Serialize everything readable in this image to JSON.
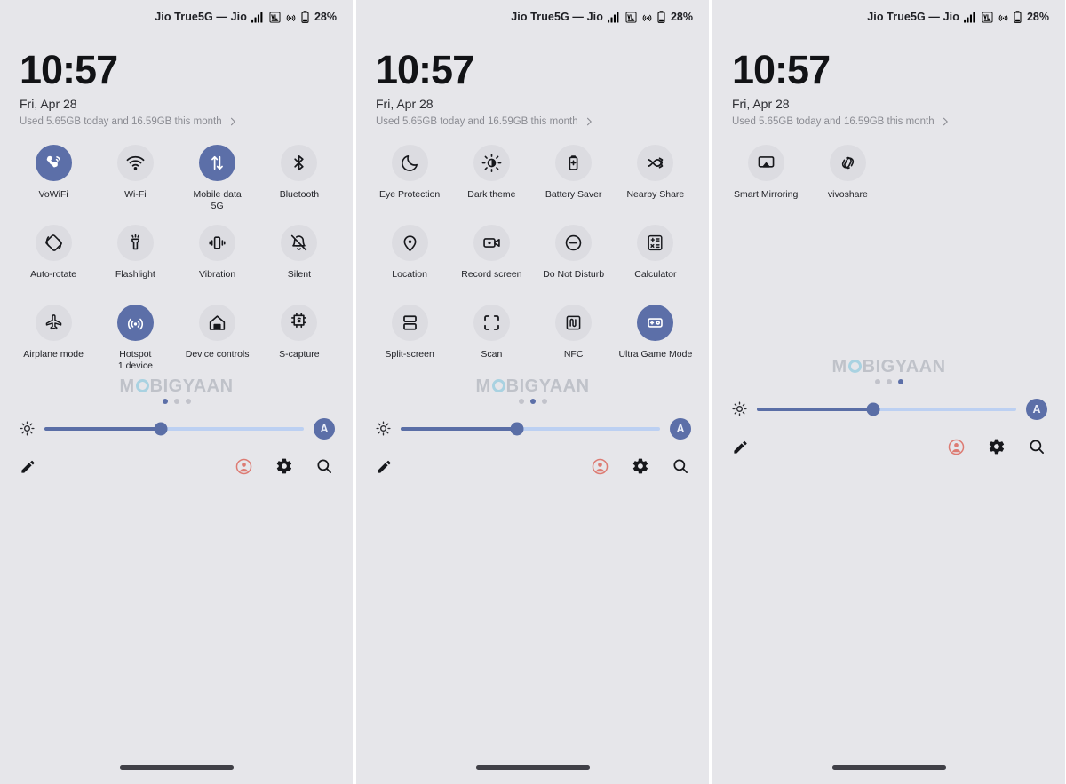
{
  "statusbar": {
    "carrier": "Jio True5G — Jio",
    "icons": [
      "signal-bars-icon",
      "volte-icon",
      "hotspot-icon",
      "battery-icon"
    ],
    "battery_percent": "28%"
  },
  "header": {
    "clock": "10:57",
    "date": "Fri, Apr 28",
    "data_usage": "Used 5.65GB today and 16.59GB this month",
    "chevron": "chevron-right-icon"
  },
  "brightness": {
    "sun_icon": "brightness-icon",
    "value_percent": 45,
    "auto_label": "A"
  },
  "bottom_actions": [
    {
      "name": "edit-tiles-button",
      "icon": "pencil-icon",
      "color": "#17181c"
    },
    {
      "name": "user-profile-button",
      "icon": "user-circle-icon",
      "color": "#dd7b73"
    },
    {
      "name": "settings-button",
      "icon": "gear-icon",
      "color": "#17181c"
    },
    {
      "name": "search-button",
      "icon": "search-icon",
      "color": "#17181c"
    }
  ],
  "watermark": {
    "before": "M",
    "o": "wm-circle-o",
    "after": "BIGYAAN"
  },
  "colors": {
    "panel_bg": "#e6e6ea",
    "tile_off_bg": "#dcdce1",
    "tile_on_bg": "#5c6fa8",
    "accent": "#5c6fa8",
    "slider_track": "#bcd0f2",
    "watermark_text": "#b9bcc4",
    "watermark_o": "#9fcfe0"
  },
  "panels": [
    {
      "id": "panel-1",
      "page_index": 0,
      "total_pages": 3,
      "tiles": [
        {
          "label": "VoWiFi",
          "sub": "",
          "icon": "vowifi-icon",
          "active": true
        },
        {
          "label": "Wi-Fi",
          "sub": "",
          "icon": "wifi-icon",
          "active": false
        },
        {
          "label": "Mobile data",
          "sub": "5G",
          "icon": "mobile-data-icon",
          "active": true
        },
        {
          "label": "Bluetooth",
          "sub": "",
          "icon": "bluetooth-icon",
          "active": false
        },
        {
          "label": "Auto-rotate",
          "sub": "",
          "icon": "auto-rotate-icon",
          "active": false
        },
        {
          "label": "Flashlight",
          "sub": "",
          "icon": "flashlight-icon",
          "active": false
        },
        {
          "label": "Vibration",
          "sub": "",
          "icon": "vibration-icon",
          "active": false
        },
        {
          "label": "Silent",
          "sub": "",
          "icon": "bell-off-icon",
          "active": false
        },
        {
          "label": "Airplane mode",
          "sub": "",
          "icon": "airplane-icon",
          "active": false
        },
        {
          "label": "Hotspot",
          "sub": "1 device",
          "icon": "hotspot-icon",
          "active": true
        },
        {
          "label": "Device controls",
          "sub": "",
          "icon": "home-icon",
          "active": false
        },
        {
          "label": "S-capture",
          "sub": "",
          "icon": "s-capture-icon",
          "active": false
        }
      ]
    },
    {
      "id": "panel-2",
      "page_index": 1,
      "total_pages": 3,
      "tiles": [
        {
          "label": "Eye Protection",
          "sub": "",
          "icon": "moon-icon",
          "active": false
        },
        {
          "label": "Dark theme",
          "sub": "",
          "icon": "dark-theme-icon",
          "active": false
        },
        {
          "label": "Battery Saver",
          "sub": "",
          "icon": "battery-saver-icon",
          "active": false
        },
        {
          "label": "Nearby Share",
          "sub": "",
          "icon": "nearby-share-icon",
          "active": false
        },
        {
          "label": "Location",
          "sub": "",
          "icon": "location-pin-icon",
          "active": false
        },
        {
          "label": "Record screen",
          "sub": "",
          "icon": "record-screen-icon",
          "active": false
        },
        {
          "label": "Do Not Disturb",
          "sub": "",
          "icon": "dnd-icon",
          "active": false
        },
        {
          "label": "Calculator",
          "sub": "",
          "icon": "calculator-icon",
          "active": false
        },
        {
          "label": "Split-screen",
          "sub": "",
          "icon": "split-screen-icon",
          "active": false
        },
        {
          "label": "Scan",
          "sub": "",
          "icon": "scan-icon",
          "active": false
        },
        {
          "label": "NFC",
          "sub": "",
          "icon": "nfc-icon",
          "active": false
        },
        {
          "label": "Ultra Game Mode",
          "sub": "",
          "icon": "game-mode-icon",
          "active": true
        }
      ]
    },
    {
      "id": "panel-3",
      "page_index": 2,
      "total_pages": 3,
      "tiles": [
        {
          "label": "Smart Mirroring",
          "sub": "",
          "icon": "cast-icon",
          "active": false
        },
        {
          "label": "vivoshare",
          "sub": "",
          "icon": "link-icon",
          "active": false
        }
      ]
    }
  ]
}
